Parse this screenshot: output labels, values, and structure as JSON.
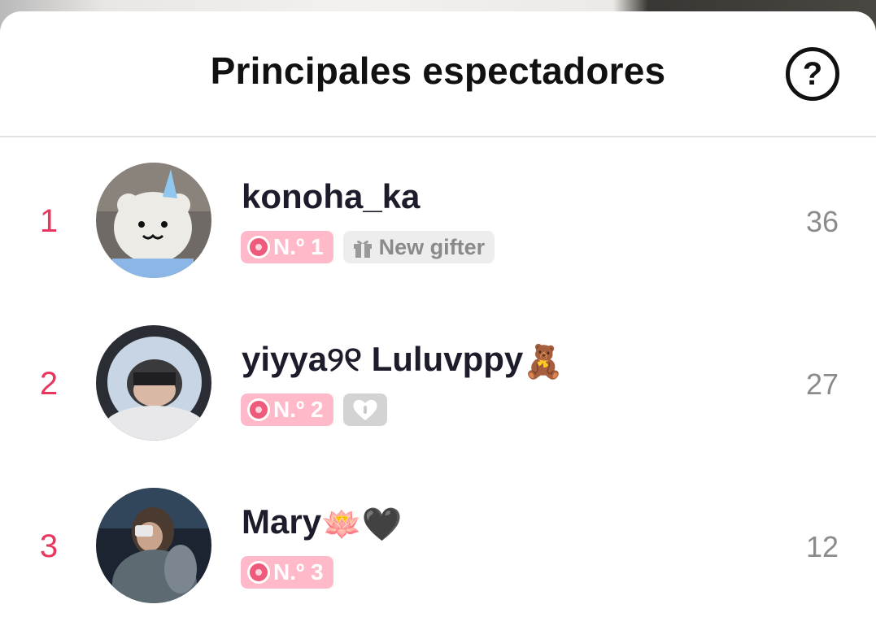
{
  "header": {
    "title": "Principales espectadores",
    "help_icon": "question-circle-icon",
    "help_label": "?"
  },
  "viewers": [
    {
      "rank": "1",
      "name": "konoha_ka",
      "rank_badge": "N.º 1",
      "extra_badge": "New gifter",
      "score": "36"
    },
    {
      "rank": "2",
      "name": "yiyya୨୧ Luluvppy",
      "name_emoji": "🧸",
      "rank_badge": "N.º 2",
      "extra_badge_icon": "heart-lock-icon",
      "score": "27"
    },
    {
      "rank": "3",
      "name": "Mary",
      "name_emoji": "🪷🖤",
      "rank_badge": "N.º 3",
      "score": "12"
    }
  ],
  "colors": {
    "rank": "#e8365f",
    "rank_badge_bg": "#ffb9c8",
    "medal": "#ee5a7c",
    "score": "#8b8b8b"
  }
}
